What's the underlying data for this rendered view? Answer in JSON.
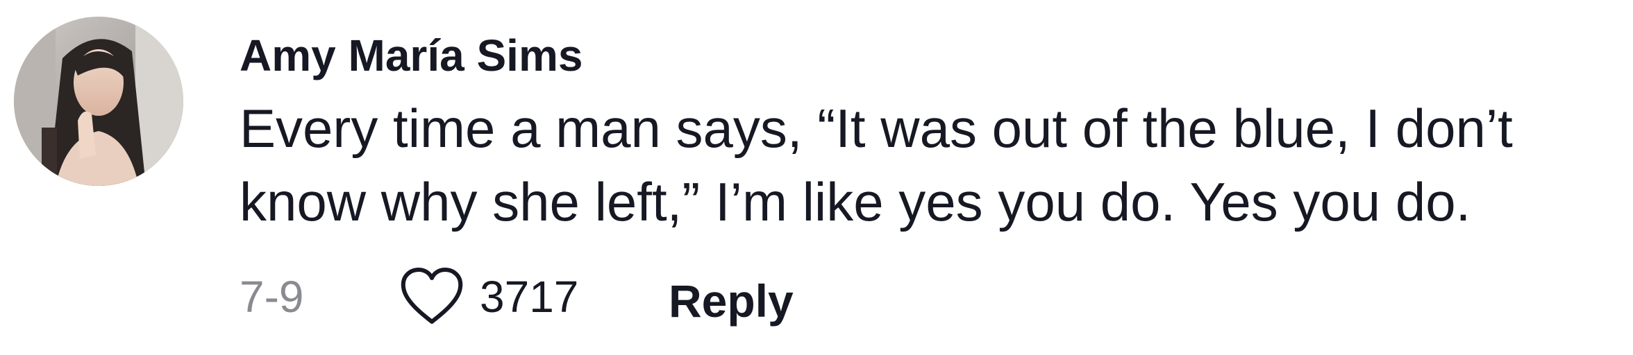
{
  "comment": {
    "avatar": {
      "icon": "user-avatar-photo"
    },
    "username": "Amy María Sims",
    "text_lines": [
      "Every time a man says, “It was out of the blue, I don’t",
      "know why she left,” I’m like yes you do. Yes you do."
    ],
    "date": "7-9",
    "like": {
      "icon": "heart-icon",
      "count": "3717"
    },
    "reply_label": "Reply"
  },
  "colors": {
    "text_primary": "#161823",
    "text_secondary": "#8a8b91",
    "icon_stroke": "#161823",
    "background": "#ffffff"
  }
}
